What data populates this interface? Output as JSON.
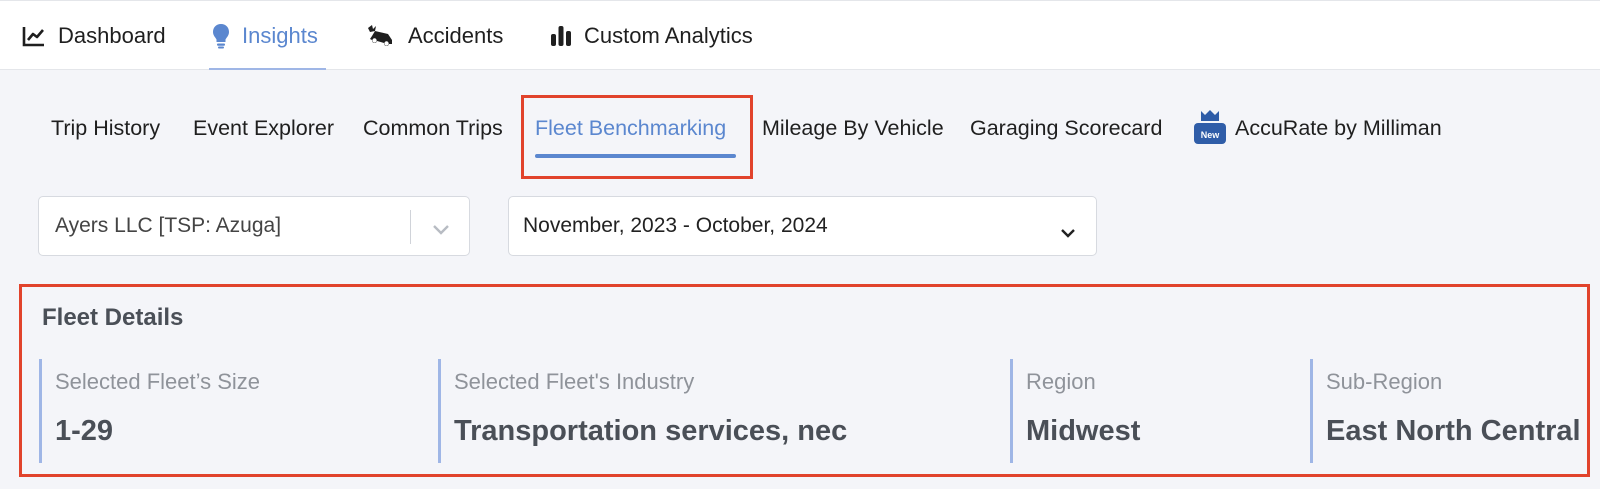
{
  "top_nav": [
    {
      "label": "Dashboard",
      "icon": "line-chart-icon"
    },
    {
      "label": "Insights",
      "icon": "lightbulb-icon",
      "active": true
    },
    {
      "label": "Accidents",
      "icon": "car-crash-icon"
    },
    {
      "label": "Custom Analytics",
      "icon": "bar-chart-icon"
    }
  ],
  "sub_nav": [
    {
      "label": "Trip History"
    },
    {
      "label": "Event Explorer"
    },
    {
      "label": "Common Trips"
    },
    {
      "label": "Fleet Benchmarking",
      "active": true
    },
    {
      "label": "Mileage By Vehicle"
    },
    {
      "label": "Garaging Scorecard"
    },
    {
      "label": "AccuRate by Milliman",
      "badge": "New",
      "icon": "crown-icon"
    }
  ],
  "filters": {
    "account": "Ayers LLC [TSP: Azuga]",
    "date_range": "November, 2023 - October, 2024"
  },
  "fleet_details": {
    "title": "Fleet Details",
    "items": [
      {
        "label": "Selected Fleet’s Size",
        "value": "1-29"
      },
      {
        "label": "Selected Fleet's Industry",
        "value": "Transportation services, nec"
      },
      {
        "label": "Region",
        "value": "Midwest"
      },
      {
        "label": "Sub-Region",
        "value": "East North Central"
      }
    ]
  },
  "colors": {
    "accent": "#5b87cf",
    "highlight": "#e1432c",
    "muted_text": "#8f939a",
    "value_text": "#4a4f57"
  }
}
